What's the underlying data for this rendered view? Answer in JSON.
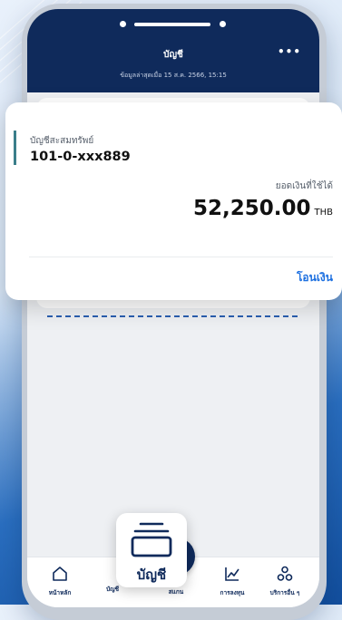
{
  "header": {
    "title": "บัญชี",
    "subtitle": "ข้อมูลล่าสุดเมื่อ 15 ส.ค. 2566, 15:15",
    "more_icon": "more-horizontal-icon"
  },
  "account_card": {
    "type_label": "บัญชีสะสมทรัพย์",
    "number": "101-0-xxx889",
    "balance_label": "ยอดเงินที่ใช้ได้",
    "balance": "52,250.00",
    "currency": "THB",
    "transfer_label": "โอนเงิน"
  },
  "nav": {
    "items": [
      {
        "label": "หน้าหลัก",
        "icon": "home-icon"
      },
      {
        "label": "บัญชี",
        "icon": "account-stack-icon"
      },
      {
        "label": "สแกน",
        "icon": "scan-icon"
      },
      {
        "label": "การลงทุน",
        "icon": "chart-line-icon"
      },
      {
        "label": "บริการอื่น ๆ",
        "icon": "other-services-icon"
      }
    ],
    "active": "บัญชี"
  },
  "colors": {
    "navy": "#0f2a5b",
    "link_blue": "#1c6fe0",
    "accent_teal": "#3a7e8a"
  }
}
